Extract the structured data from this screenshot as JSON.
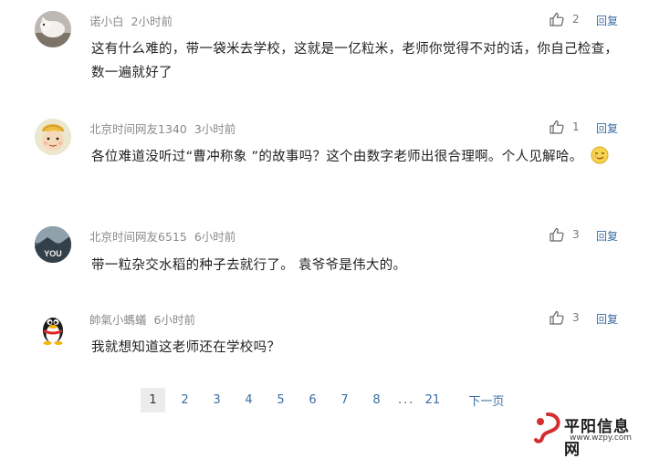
{
  "comments": [
    {
      "username": "诺小白",
      "time": "2小时前",
      "text": "这有什么难的，带一袋米去学校，这就是一亿粒米，老师你觉得不对的话，你自己检查，数一遍就好了",
      "likes": "2",
      "reply_label": "回复",
      "avatar": "white-cat-photo"
    },
    {
      "username": "北京时间网友1340",
      "time": "3小时前",
      "text": "各位难道没听过“曹冲称象 ”的故事吗？这个由数字老师出很合理啊。个人见解哈。",
      "likes": "1",
      "reply_label": "回复",
      "avatar": "cartoon-face",
      "emoji": "smirk-emoji"
    },
    {
      "username": "北京时间网友6515",
      "time": "6小时前",
      "text": "带一粒杂交水稻的种子去就行了。 袁爷爷是伟大的。",
      "likes": "3",
      "reply_label": "回复",
      "avatar": "you-photo",
      "avatar_text": "YOU"
    },
    {
      "username": "帥氣小螞蟻",
      "time": "6小时前",
      "text": "我就想知道这老师还在学校吗？",
      "likes": "3",
      "reply_label": "回复",
      "avatar": "qq-penguin"
    }
  ],
  "pagination": {
    "pages": [
      "1",
      "2",
      "3",
      "4",
      "5",
      "6",
      "7",
      "8"
    ],
    "current": "1",
    "ellipsis": "...",
    "last": "21",
    "next_label": "下一页"
  },
  "watermark": {
    "brand": "平阳信息网",
    "url": "www.wzpy.com"
  },
  "colors": {
    "link": "#3a6ea5",
    "meta": "#8a8a8a",
    "active_page_bg": "#ececec"
  }
}
